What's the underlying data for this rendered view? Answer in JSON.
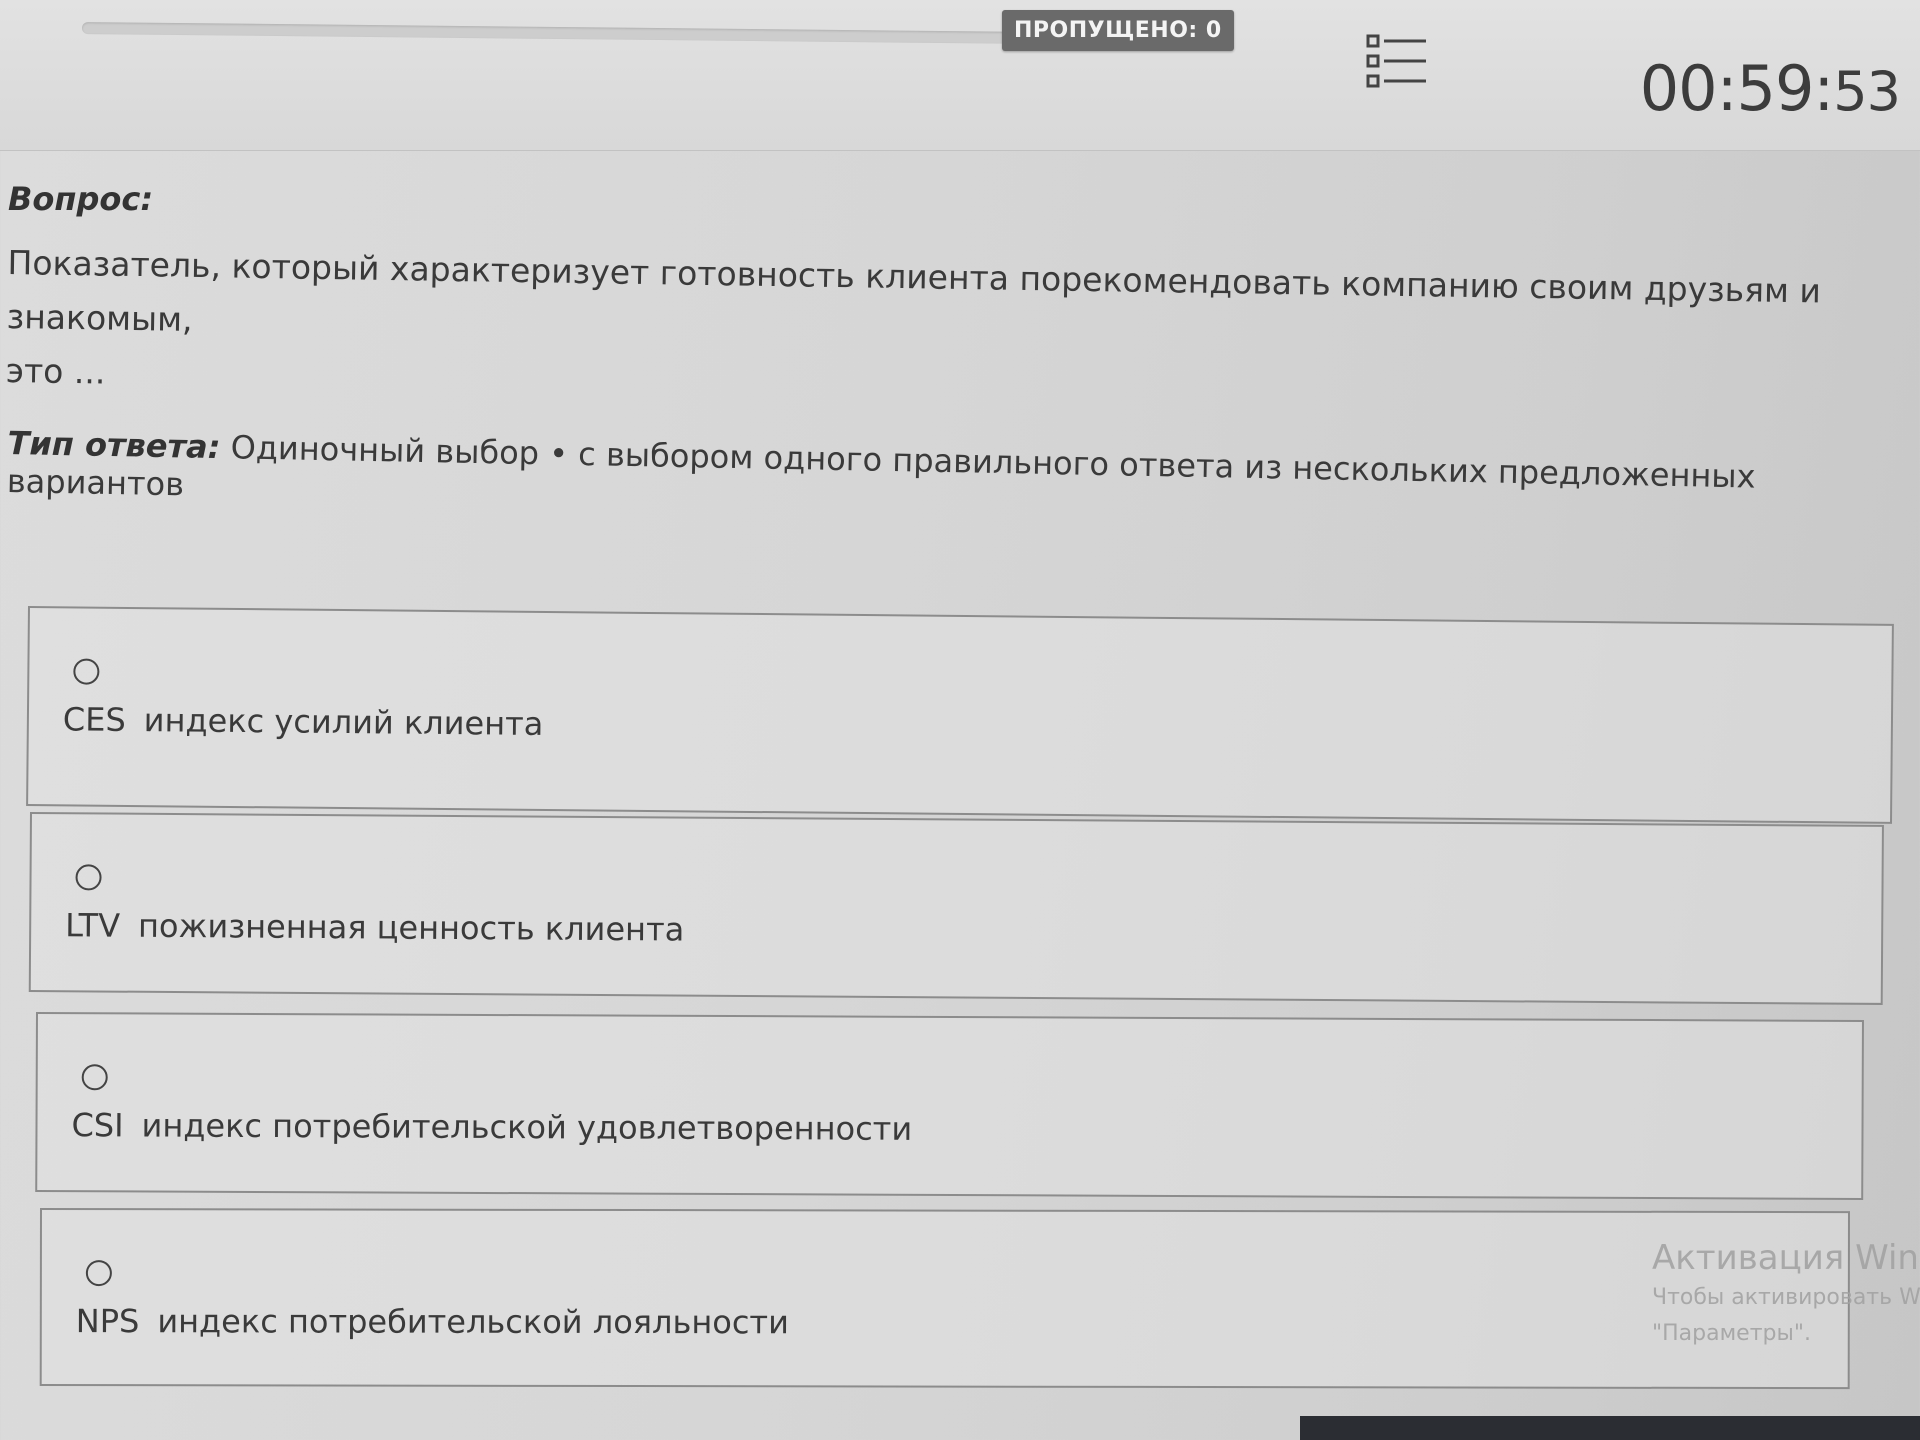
{
  "header": {
    "skipped_label": "ПРОПУЩЕНО: 0",
    "timer_main": "00:59:",
    "timer_seconds": "53",
    "list_icon": "question-list-icon"
  },
  "question": {
    "label": "Вопрос:",
    "text_line1": "Показатель, который характеризует готовность клиента порекомендовать компанию своим друзьям и знакомым,",
    "text_line2": "это ..."
  },
  "answer_type": {
    "label": "Тип ответа:",
    "value": "Одиночный выбор • с выбором одного правильного ответа из нескольких предложенных вариантов"
  },
  "options": [
    {
      "abbr": "CES",
      "text": "индекс усилий клиента",
      "selected": false
    },
    {
      "abbr": "LTV",
      "text": "пожизненная ценность клиента",
      "selected": false
    },
    {
      "abbr": "CSI",
      "text": "индекс потребительской удовлетворенности",
      "selected": false
    },
    {
      "abbr": "NPS",
      "text": "индекс потребительской лояльности",
      "selected": false
    }
  ],
  "watermark": {
    "title": "Активация Winc",
    "line1": "Чтобы активировать W",
    "line2": "\"Параметры\"."
  }
}
